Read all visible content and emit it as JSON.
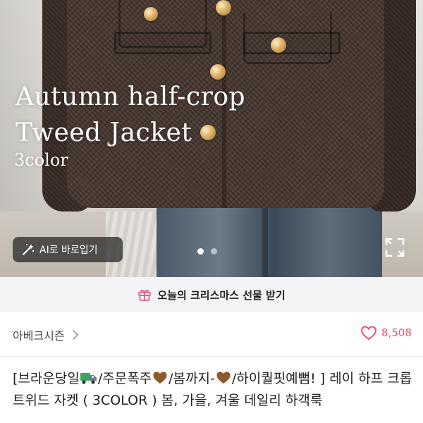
{
  "hero": {
    "title_line1": "Autumn half-crop",
    "title_line2": "Tweed Jacket",
    "subtitle": "3color",
    "ai_button_label": "AI로 바로입기",
    "carousel_total": 2,
    "carousel_active": 1
  },
  "promo": {
    "text": "오늘의 크리스마스 선물 받기",
    "icon": "gift-icon"
  },
  "shop": {
    "name": "아베크시즌",
    "like_count": "8,508"
  },
  "product": {
    "title_seg1": "[브라운당일",
    "title_seg2": "/주문폭주",
    "title_seg3": "/봄까지-",
    "title_seg4": "/하이퀄핏예뻠! ] 레이 하프 크롭 트위드 자켓 ( 3COLOR ) 봄, 가을, 겨울 데일리 하객룩"
  },
  "colors": {
    "accent": "#f0536e",
    "gift": "#e0608d",
    "truck_body": "#3aa55a",
    "heart_brown": "#8b5a2b"
  }
}
